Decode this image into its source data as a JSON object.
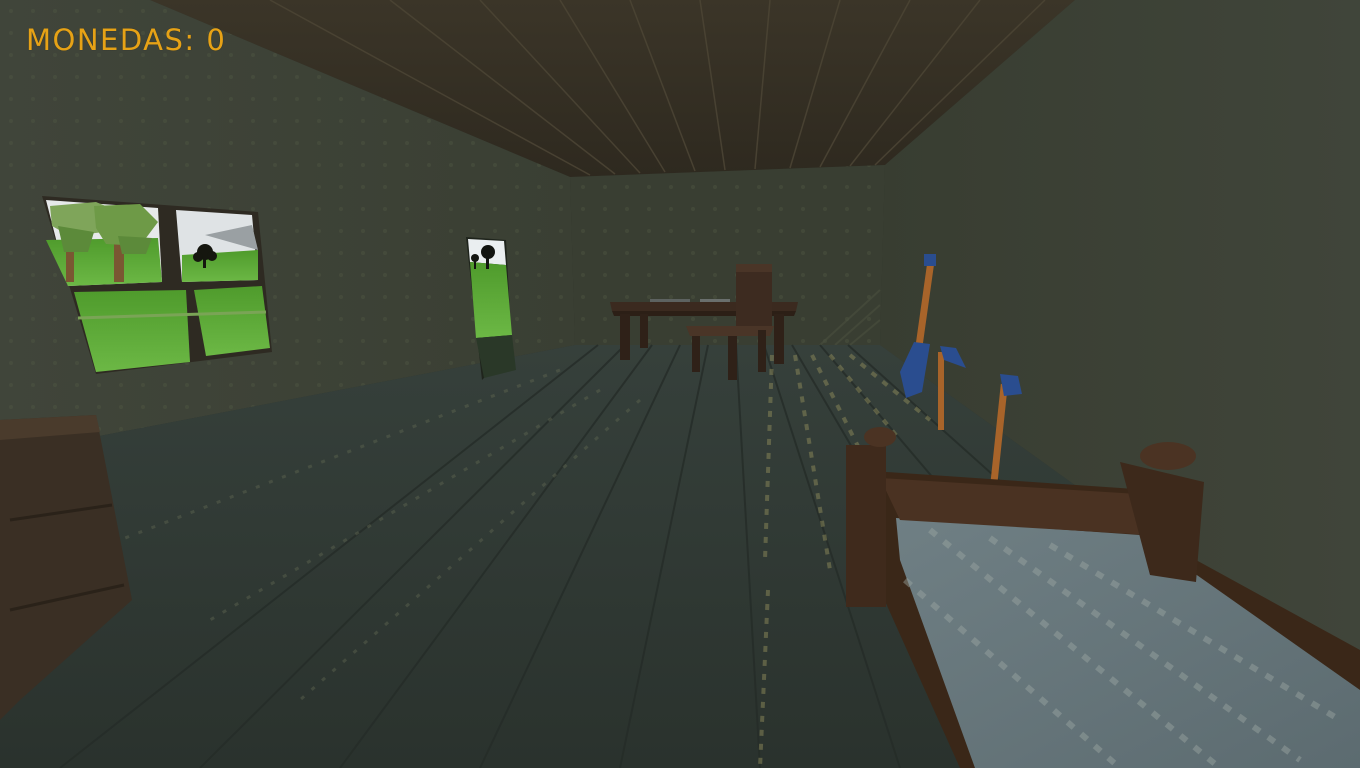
{
  "hud": {
    "coins_label": "MONEDAS:",
    "coins_value": "0"
  },
  "colors": {
    "hud_text": "#e6a216",
    "ceiling": "#3b3528",
    "left_wall": "#3d4235",
    "back_wall": "#3a3f33",
    "right_wall": "#3c4135",
    "floor": "#2f3832",
    "grass": "#5ea83a",
    "sky": "#e9ecef",
    "wood": "#4a2e1f",
    "blanket": "#66767c",
    "tool_metal": "#2a4d8f"
  },
  "scene": {
    "objects": [
      "window",
      "doorway",
      "table",
      "chair",
      "shovel",
      "hammer",
      "axe",
      "bed",
      "dresser"
    ]
  }
}
